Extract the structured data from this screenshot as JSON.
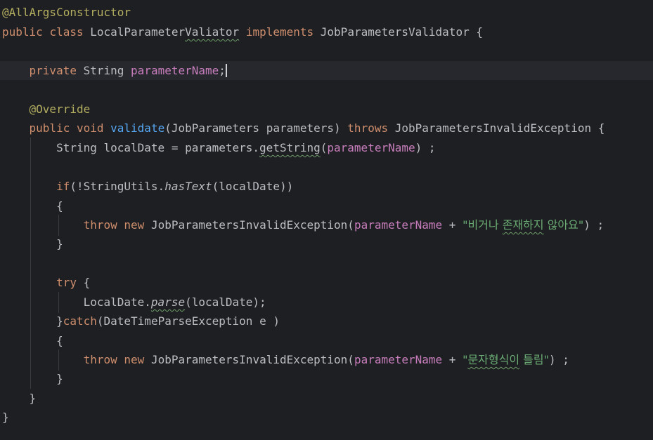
{
  "code": {
    "l1_annotation": "@AllArgsConstructor",
    "l2_public": "public",
    "l2_class": "class",
    "l2_name_a": "LocalParameter",
    "l2_name_b": "Valiator",
    "l2_implements": "implements",
    "l2_iface": "JobParametersValidator",
    "l2_brace": "{",
    "l4_private": "private",
    "l4_type": "String",
    "l4_field": "parameterName",
    "l4_semi": ";",
    "l6_annotation": "@Override",
    "l7_public": "public",
    "l7_void": "void",
    "l7_method": "validate",
    "l7_params": "(JobParameters parameters)",
    "l7_throws": "throws",
    "l7_exc": "JobParametersInvalidException {",
    "l8_a": "String localDate = parameters.",
    "l8_call": "getString",
    "l8_open": "(",
    "l8_field": "parameterName",
    "l8_close": ") ;",
    "l10_if": "if",
    "l10_a": "(!StringUtils.",
    "l10_call": "hasText",
    "l10_b": "(localDate))",
    "l11_brace": "{",
    "l12_throw": "throw",
    "l12_new": "new",
    "l12_exc": "JobParametersInvalidException(",
    "l12_field": "parameterName",
    "l12_plus": " + ",
    "l12_str_a": "\"비거나 ",
    "l12_str_b": "존재하지",
    "l12_str_c": " 않아요\"",
    "l12_end": ") ;",
    "l13_brace": "}",
    "l15_try": "try",
    "l15_brace": " {",
    "l16_a": "LocalDate.",
    "l16_call": "parse",
    "l16_b": "(localDate);",
    "l17_brace": "}",
    "l17_catch": "catch",
    "l17_b": "(DateTimeParseException e )",
    "l18_brace": "{",
    "l19_throw": "throw",
    "l19_new": "new",
    "l19_exc": "JobParametersInvalidException(",
    "l19_field": "parameterName",
    "l19_plus": " + ",
    "l19_str_a": "\"",
    "l19_str_b": "문자형식이",
    "l19_str_c": " 틀림\"",
    "l19_end": ") ;",
    "l20_brace": "}",
    "l21_brace": "}",
    "l22_brace": "}"
  },
  "colors": {
    "background": "#1e1f22",
    "current_line": "#26282e",
    "annotation": "#b3ae60",
    "keyword": "#cf8e6d",
    "field": "#c77dbb",
    "method": "#56a8f5",
    "string": "#6aab73",
    "text": "#bcbec4"
  }
}
